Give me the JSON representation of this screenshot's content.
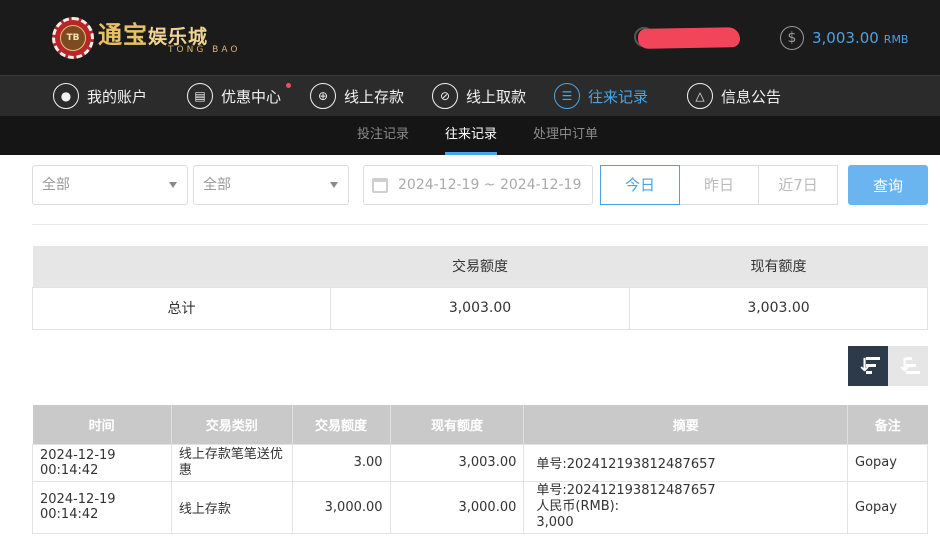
{
  "header": {
    "logo_chip": "TB",
    "logo_main": "通宝",
    "logo_sub": "娱乐城",
    "logo_en": "TONG BAO",
    "balance_icon": "dollar-circle-icon",
    "balance_amount": "3,003.00",
    "balance_unit": "RMB"
  },
  "nav": {
    "items": [
      {
        "label": "我的账户",
        "icon": "user-icon"
      },
      {
        "label": "优惠中心",
        "icon": "gift-icon",
        "badge": true
      },
      {
        "label": "线上存款",
        "icon": "deposit-icon"
      },
      {
        "label": "线上取款",
        "icon": "withdraw-icon"
      },
      {
        "label": "往来记录",
        "icon": "records-icon",
        "active": true
      },
      {
        "label": "信息公告",
        "icon": "bell-icon"
      }
    ]
  },
  "subnav": {
    "items": [
      "投注记录",
      "往来记录",
      "处理中订单"
    ],
    "active_index": 1
  },
  "filters": {
    "select1": "全部",
    "select2": "全部",
    "date_range": "2024-12-19 ~ 2024-12-19",
    "quick": [
      "今日",
      "昨日",
      "近7日"
    ],
    "quick_active": 0,
    "query_label": "查询"
  },
  "summary": {
    "headers": [
      "",
      "交易额度",
      "现有额度"
    ],
    "row": [
      "总计",
      "3,003.00",
      "3,003.00"
    ]
  },
  "records": {
    "headers": [
      "时间",
      "交易类别",
      "交易额度",
      "现有额度",
      "摘要",
      "备注"
    ],
    "rows": [
      {
        "time": "2024-12-19 00:14:42",
        "type": "线上存款笔笔送优惠",
        "amount": "3.00",
        "balance": "3,003.00",
        "summary_l1": "单号:202412193812487657",
        "summary_l2": "",
        "summary_l3": "",
        "note": "Gopay"
      },
      {
        "time": "2024-12-19 00:14:42",
        "type": "线上存款",
        "amount": "3,000.00",
        "balance": "3,000.00",
        "summary_l1": "单号:202412193812487657",
        "summary_l2": "人民币(RMB):",
        "summary_l3": "3,000",
        "note": "Gopay"
      }
    ]
  },
  "colors": {
    "accent": "#4aa3e6",
    "header_bg": "#1b1b1b",
    "nav_bg": "#2b2b2b",
    "subnav_bg": "#151515",
    "redaction": "#f2455a"
  }
}
